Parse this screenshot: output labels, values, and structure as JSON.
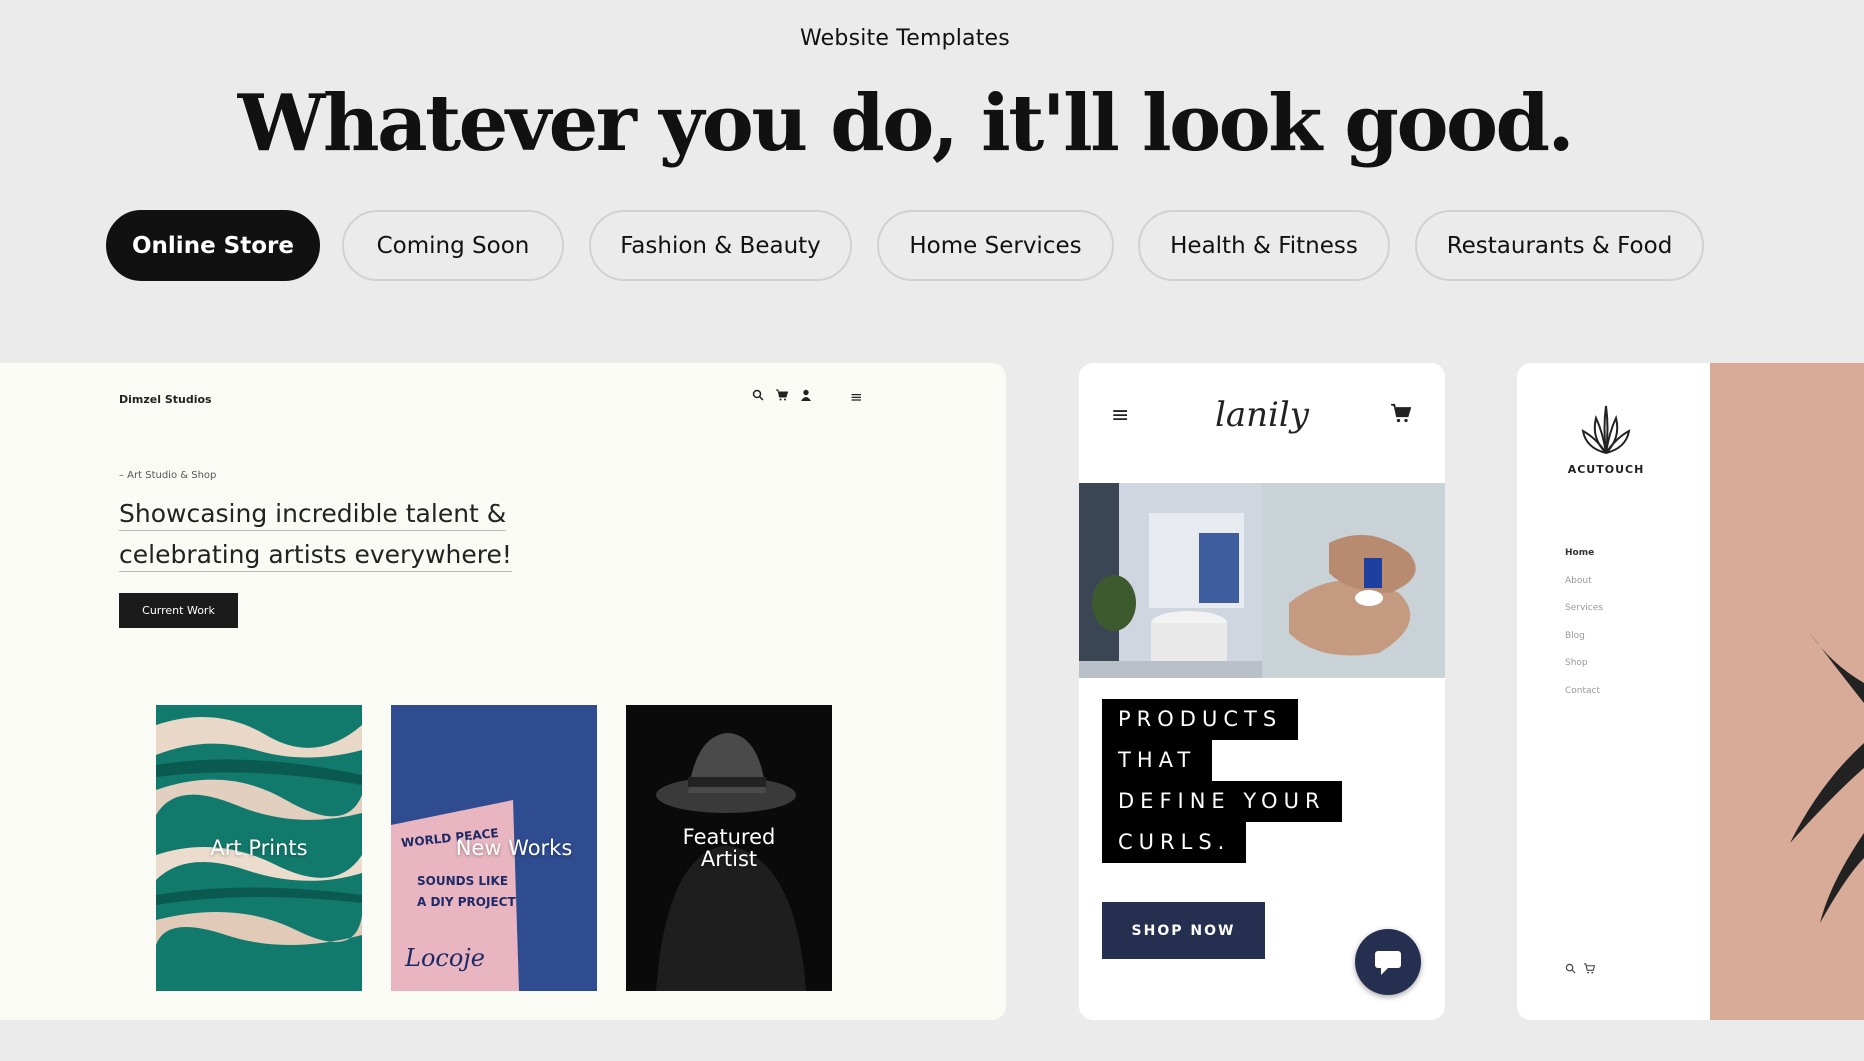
{
  "header": {
    "eyebrow": "Website Templates",
    "headline": "Whatever you do, it'll look good."
  },
  "tabs": [
    {
      "label": "Online Store",
      "active": true
    },
    {
      "label": "Coming Soon",
      "active": false
    },
    {
      "label": "Fashion & Beauty",
      "active": false
    },
    {
      "label": "Home Services",
      "active": false
    },
    {
      "label": "Health & Fitness",
      "active": false
    },
    {
      "label": "Restaurants & Food",
      "active": false
    }
  ],
  "template_art": {
    "brand": "Dimzel Studios",
    "icons": [
      "search-icon",
      "cart-icon",
      "user-icon",
      "menu-icon"
    ],
    "kicker": "– Art Studio & Shop",
    "heading_line1": "Showcasing incredible talent &",
    "heading_line2": "celebrating artists everywhere!",
    "button": "Current Work",
    "tiles": [
      {
        "label": "Art Prints"
      },
      {
        "label": "New Works",
        "poster_line1": "WORLD PEACE",
        "poster_line2": "SOUNDS LIKE",
        "poster_line3": "A DIY PROJECT",
        "signature": "Locoje"
      },
      {
        "label_line1": "Featured",
        "label_line2": "Artist"
      }
    ]
  },
  "template_lanily": {
    "logo": "lanily",
    "icons": [
      "menu-icon",
      "cart-icon",
      "chat-icon"
    ],
    "lines": [
      "PRODUCTS",
      "THAT",
      "DEFINE YOUR",
      "CURLS."
    ],
    "button": "SHOP NOW"
  },
  "template_acutouch": {
    "logo": "ACUTOUCH",
    "nav": [
      "Home",
      "About",
      "Services",
      "Blog",
      "Shop",
      "Contact"
    ],
    "icons": [
      "search-icon",
      "cart-icon"
    ]
  },
  "colors": {
    "background": "#ebebec",
    "active_tab": "#111111",
    "navy_button": "#253050",
    "blush_photo": "#d8ab98"
  }
}
